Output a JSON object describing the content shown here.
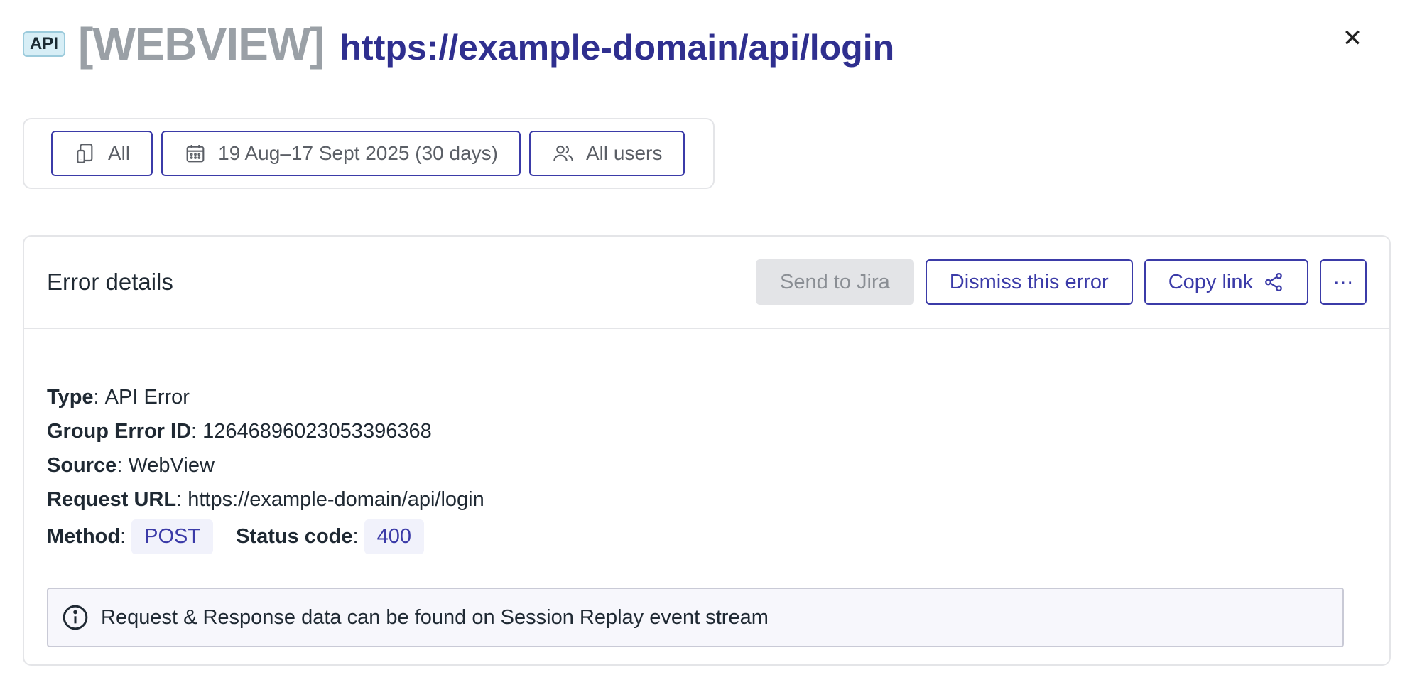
{
  "header": {
    "badge": "API",
    "tag": "[WEBVIEW]",
    "url": "https://example-domain/api/login",
    "close_glyph": "✕"
  },
  "filters": {
    "device": {
      "label": "All",
      "icon": "device-icon"
    },
    "date": {
      "label": "19 Aug–17 Sept 2025 (30 days)",
      "icon": "calendar-icon"
    },
    "users": {
      "label": "All users",
      "icon": "users-icon"
    }
  },
  "card": {
    "title": "Error details",
    "actions": {
      "jira": "Send to Jira",
      "dismiss": "Dismiss this error",
      "copy": "Copy link",
      "more": "···"
    },
    "details": {
      "type_label": "Type",
      "type_value": "API Error",
      "group_label": "Group Error ID",
      "group_value": "12646896023053396368",
      "source_label": "Source",
      "source_value": "WebView",
      "url_label": "Request URL",
      "url_value": "https://example-domain/api/login",
      "method_label": "Method",
      "method_value": "POST",
      "status_label": "Status code",
      "status_value": "400"
    },
    "info": "Request & Response data can be found on Session Replay event stream"
  },
  "colors": {
    "accent": "#3b3ba8",
    "title": "#2f2f8f",
    "muted": "#9aa0a6"
  }
}
